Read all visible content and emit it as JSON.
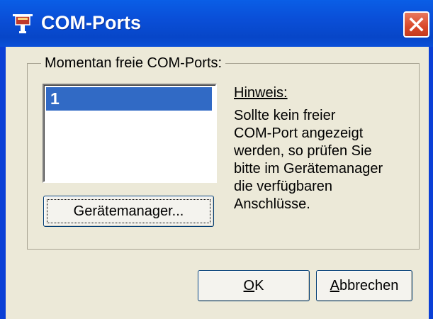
{
  "window": {
    "title": "COM-Ports"
  },
  "group": {
    "label": "Momentan freie COM-Ports:"
  },
  "ports": {
    "items": [
      "1"
    ],
    "selected": "1"
  },
  "buttons": {
    "device_manager": "Gerätemanager...",
    "ok_accel": "O",
    "ok_rest": "K",
    "cancel_accel": "A",
    "cancel_rest": "bbrechen"
  },
  "hint": {
    "title": "Hinweis:",
    "body": "Sollte kein freier\nCOM-Port angezeigt\nwerden, so prüfen Sie\nbitte im Gerätemanager\ndie verfügbaren\nAnschlüsse."
  },
  "colors": {
    "titlebar": "#0a4fd8",
    "selection": "#316ac5",
    "close": "#d9482a",
    "dialog": "#ece9d8"
  }
}
